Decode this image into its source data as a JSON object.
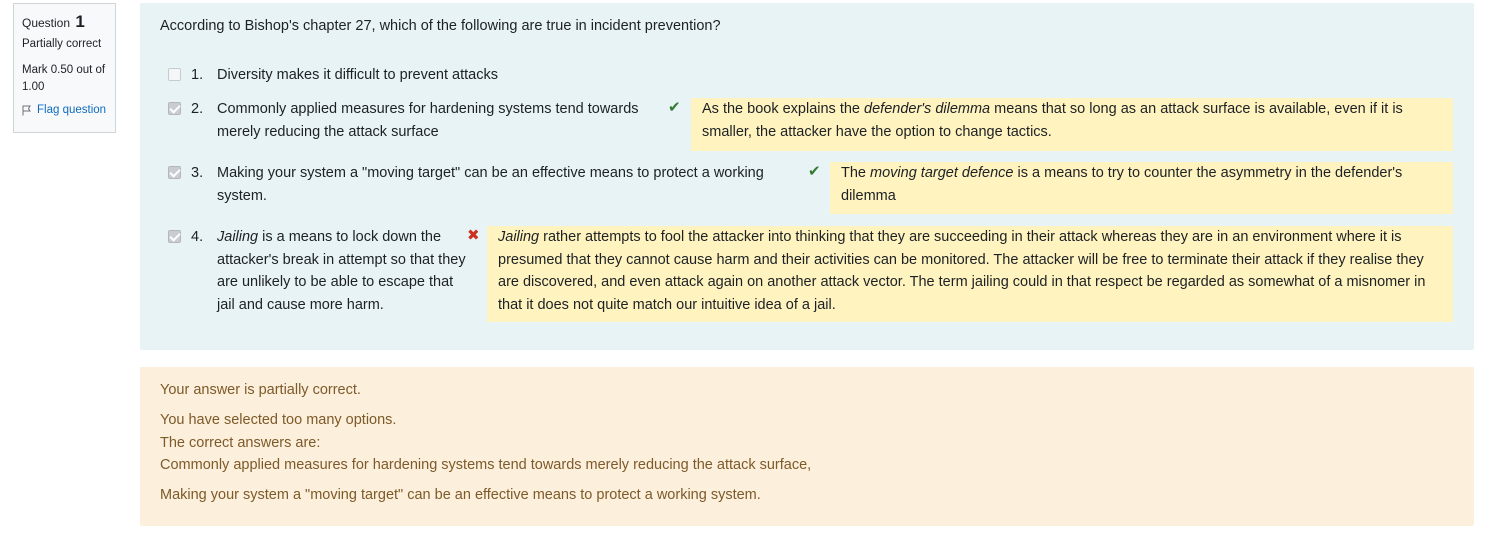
{
  "info": {
    "question_label": "Question",
    "question_number": "1",
    "state": "Partially correct",
    "grade": "Mark 0.50 out of 1.00",
    "flag_label": "Flag question"
  },
  "question": {
    "text": "According to Bishop's chapter 27, which of the following are true in incident prevention?",
    "options": [
      {
        "number": "1.",
        "checked": false,
        "label": "Diversity makes it difficult to prevent attacks"
      },
      {
        "number": "2.",
        "checked": true,
        "label": "Commonly applied measures for hardening systems tend towards merely reducing the attack surface",
        "mark": "correct",
        "feedback_pre": "As the book explains the ",
        "feedback_em": "defender's dilemma",
        "feedback_post": " means that so long as an attack surface is available, even if it is smaller, the attacker have the option to change tactics."
      },
      {
        "number": "3.",
        "checked": true,
        "label": "Making your system a \"moving target\" can be an effective means to protect a working system.",
        "mark": "correct",
        "feedback_pre": "The ",
        "feedback_em": "moving target defence",
        "feedback_post": " is a means to try to counter the asymmetry in the defender's dilemma"
      },
      {
        "number": "4.",
        "checked": true,
        "label_em": "Jailing",
        "label_post": " is a means to lock down the attacker's break in attempt so that they are unlikely to be able to escape that jail and cause more harm.",
        "mark": "incorrect",
        "feedback_em": "Jailing",
        "feedback_post": " rather attempts to fool the attacker into thinking that they are succeeding in their attack whereas they are in an environment where it is presumed that they cannot cause harm and their activities can be monitored. The attacker will be free to terminate their attack if they realise they are discovered, and even attack again on another attack vector. The term jailing could in that respect be regarded as somewhat of a misnomer in that it does not quite match our intuitive idea of a jail."
      }
    ]
  },
  "outcome": {
    "summary": "Your answer is partially correct.",
    "too_many": "You have selected too many options.",
    "correct_heading": "The correct answers are:",
    "correct_1": "Commonly applied measures for hardening systems tend towards merely reducing the attack surface,",
    "correct_2": "Making your system a \"moving target\" can be an effective means to protect a working system."
  },
  "colors": {
    "question_bg": "#e7f3f5",
    "feedback_bg": "#fff3bf",
    "outcome_bg": "#fcefdc",
    "outcome_text": "#7d5a29",
    "correct": "#357a32",
    "incorrect": "#ca3120",
    "link": "#0f6cbf"
  }
}
